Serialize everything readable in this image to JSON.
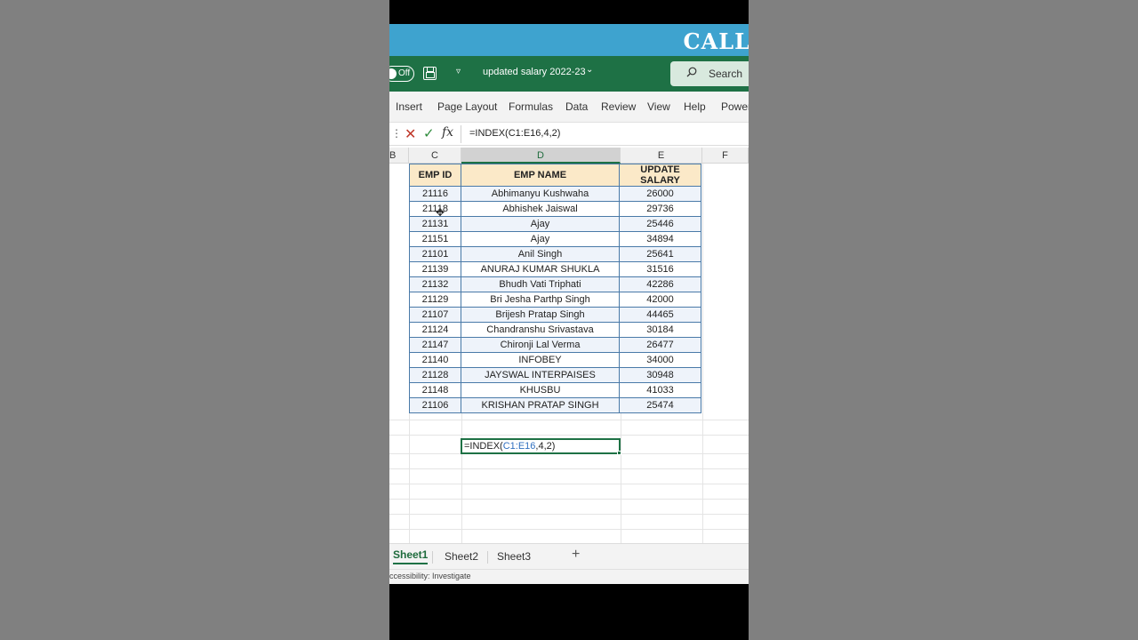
{
  "banner": {
    "text": "CALL"
  },
  "titlebar": {
    "autosave_state": "Off",
    "qat_dropdown": "▿",
    "file_name": "updated salary 2022-23",
    "file_chevron": "⌄",
    "search_label": "Search"
  },
  "ribbon": {
    "tabs": [
      "Insert",
      "Page Layout",
      "Formulas",
      "Data",
      "Review",
      "View",
      "Help",
      "Power"
    ]
  },
  "formula_bar": {
    "dots": "⋮",
    "cancel": "✕",
    "enter": "✓",
    "fx": "fx",
    "content": "=INDEX(C1:E16,4,2)"
  },
  "columns": [
    "B",
    "C",
    "D",
    "E",
    "F"
  ],
  "table": {
    "headers": [
      "EMP ID",
      "EMP NAME",
      "UPDATE SALARY"
    ],
    "rows": [
      [
        "21116",
        "Abhimanyu Kushwaha",
        "26000"
      ],
      [
        "21118",
        "Abhishek Jaiswal",
        "29736"
      ],
      [
        "21131",
        "Ajay",
        "25446"
      ],
      [
        "21151",
        "Ajay",
        "34894"
      ],
      [
        "21101",
        "Anil Singh",
        "25641"
      ],
      [
        "21139",
        "ANURAJ KUMAR SHUKLA",
        "31516"
      ],
      [
        "21132",
        "Bhudh Vati Triphati",
        "42286"
      ],
      [
        "21129",
        "Bri Jesha Parthp Singh",
        "42000"
      ],
      [
        "21107",
        "Brijesh Pratap Singh",
        "44465"
      ],
      [
        "21124",
        "Chandranshu Srivastava",
        "30184"
      ],
      [
        "21147",
        "Chironji Lal Verma",
        "26477"
      ],
      [
        "21140",
        "INFOBEY",
        "34000"
      ],
      [
        "21128",
        "JAYSWAL INTERPAISES",
        "30948"
      ],
      [
        "21148",
        "KHUSBU",
        "41033"
      ],
      [
        "21106",
        "KRISHAN PRATAP SINGH",
        "25474"
      ]
    ]
  },
  "active_cell": {
    "prefix": "=INDEX(",
    "range": "C1:E16",
    "suffix": ",4,2)"
  },
  "sheets": {
    "tabs": [
      "Sheet1",
      "Sheet2",
      "Sheet3"
    ],
    "add": "+"
  },
  "status": {
    "text": "ccessibility: Investigate"
  },
  "colors": {
    "excel_green": "#1e7145",
    "banner_blue": "#3ea3cf",
    "header_fill": "#fbe9c8",
    "table_border": "#4a7aa8",
    "ref_blue": "#2f6fbf"
  }
}
